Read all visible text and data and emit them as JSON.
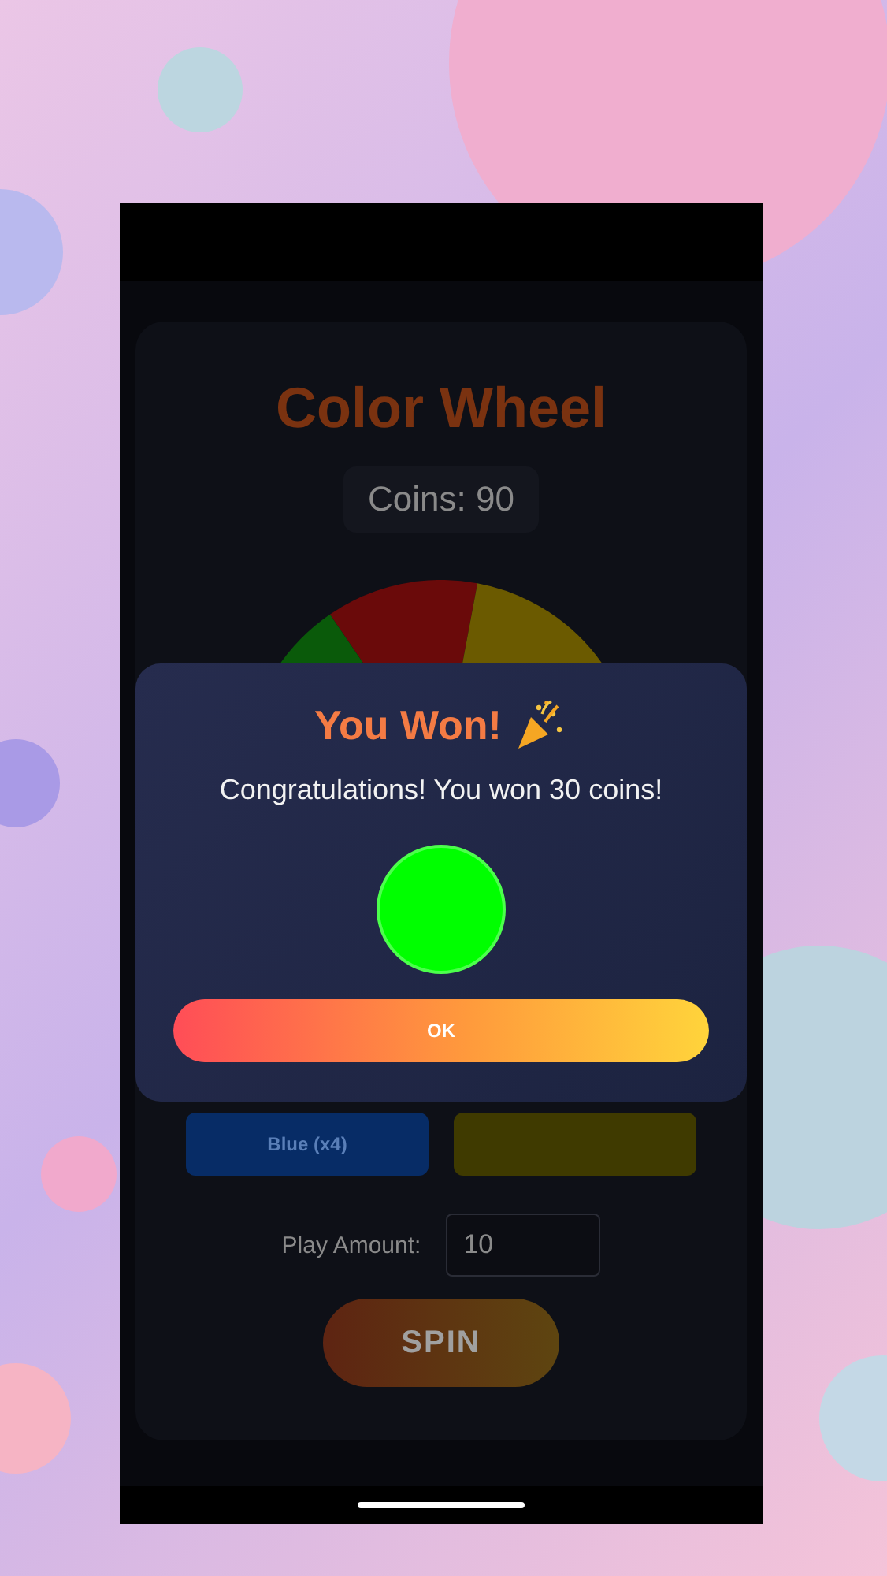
{
  "app": {
    "title": "Color Wheel",
    "coins": "Coins: 90",
    "bet_options": [
      {
        "label": "Blue (x4)",
        "color": "#072c66"
      },
      {
        "color": "#3f3a00"
      }
    ],
    "play_amount": {
      "label": "Play Amount:",
      "value": "10"
    },
    "spin_button": "SPIN"
  },
  "dialog": {
    "title": "You Won!",
    "message": "Congratulations! You won 30 coins!",
    "result": {
      "color": "#00ff00"
    },
    "button": "OK"
  }
}
